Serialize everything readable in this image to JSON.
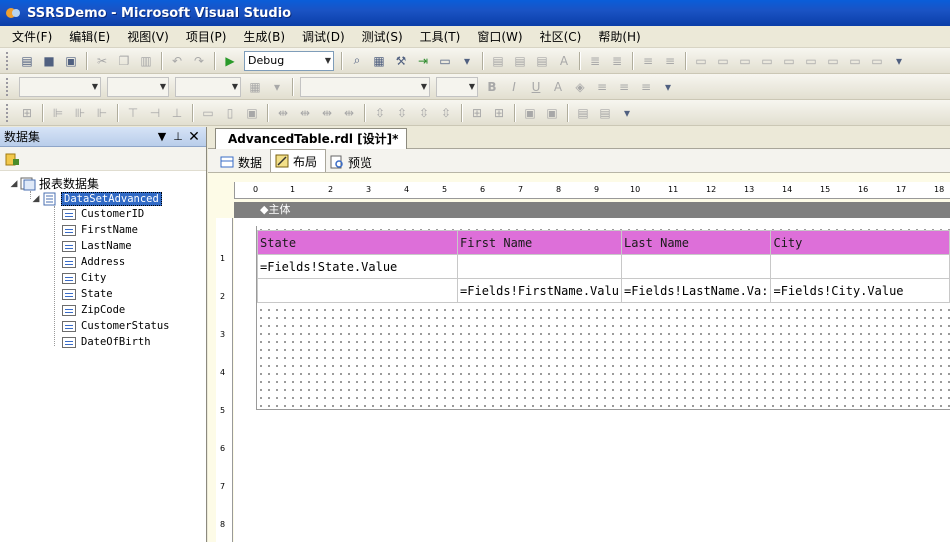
{
  "window": {
    "title": "SSRSDemo - Microsoft Visual Studio"
  },
  "menu": [
    "文件(F)",
    "编辑(E)",
    "视图(V)",
    "项目(P)",
    "生成(B)",
    "调试(D)",
    "测试(S)",
    "工具(T)",
    "窗口(W)",
    "社区(C)",
    "帮助(H)"
  ],
  "toolbar": {
    "config_value": "Debug"
  },
  "dataset_panel": {
    "title": "数据集",
    "root_label": "报表数据集",
    "dataset_label": "DataSetAdvanced",
    "fields": [
      "CustomerID",
      "FirstName",
      "LastName",
      "Address",
      "City",
      "State",
      "ZipCode",
      "CustomerStatus",
      "DateOfBirth"
    ]
  },
  "document": {
    "tab_title": "AdvancedTable.rdl [设计]*",
    "subtabs": [
      "数据",
      "布局",
      "预览"
    ],
    "body_label": "◆主体",
    "ruler_h": [
      "0",
      "1",
      "2",
      "3",
      "4",
      "5",
      "6",
      "7",
      "8",
      "9",
      "10",
      "11",
      "12",
      "13",
      "14",
      "15",
      "16",
      "17",
      "18"
    ],
    "ruler_v": [
      "1",
      "2",
      "3",
      "4",
      "5",
      "6",
      "7",
      "8"
    ]
  },
  "report_table": {
    "headers": [
      "State",
      "First Name",
      "Last Name",
      "City"
    ],
    "row1": [
      "=Fields!State.Value",
      "",
      "",
      ""
    ],
    "row2": [
      "",
      "=Fields!FirstName.Valu",
      "=Fields!LastName.Va:",
      "=Fields!City.Value"
    ]
  },
  "colors": {
    "header_bg": "#dd6fd9",
    "selection": "#316ac5",
    "title_bar": "#0b3ea8"
  }
}
